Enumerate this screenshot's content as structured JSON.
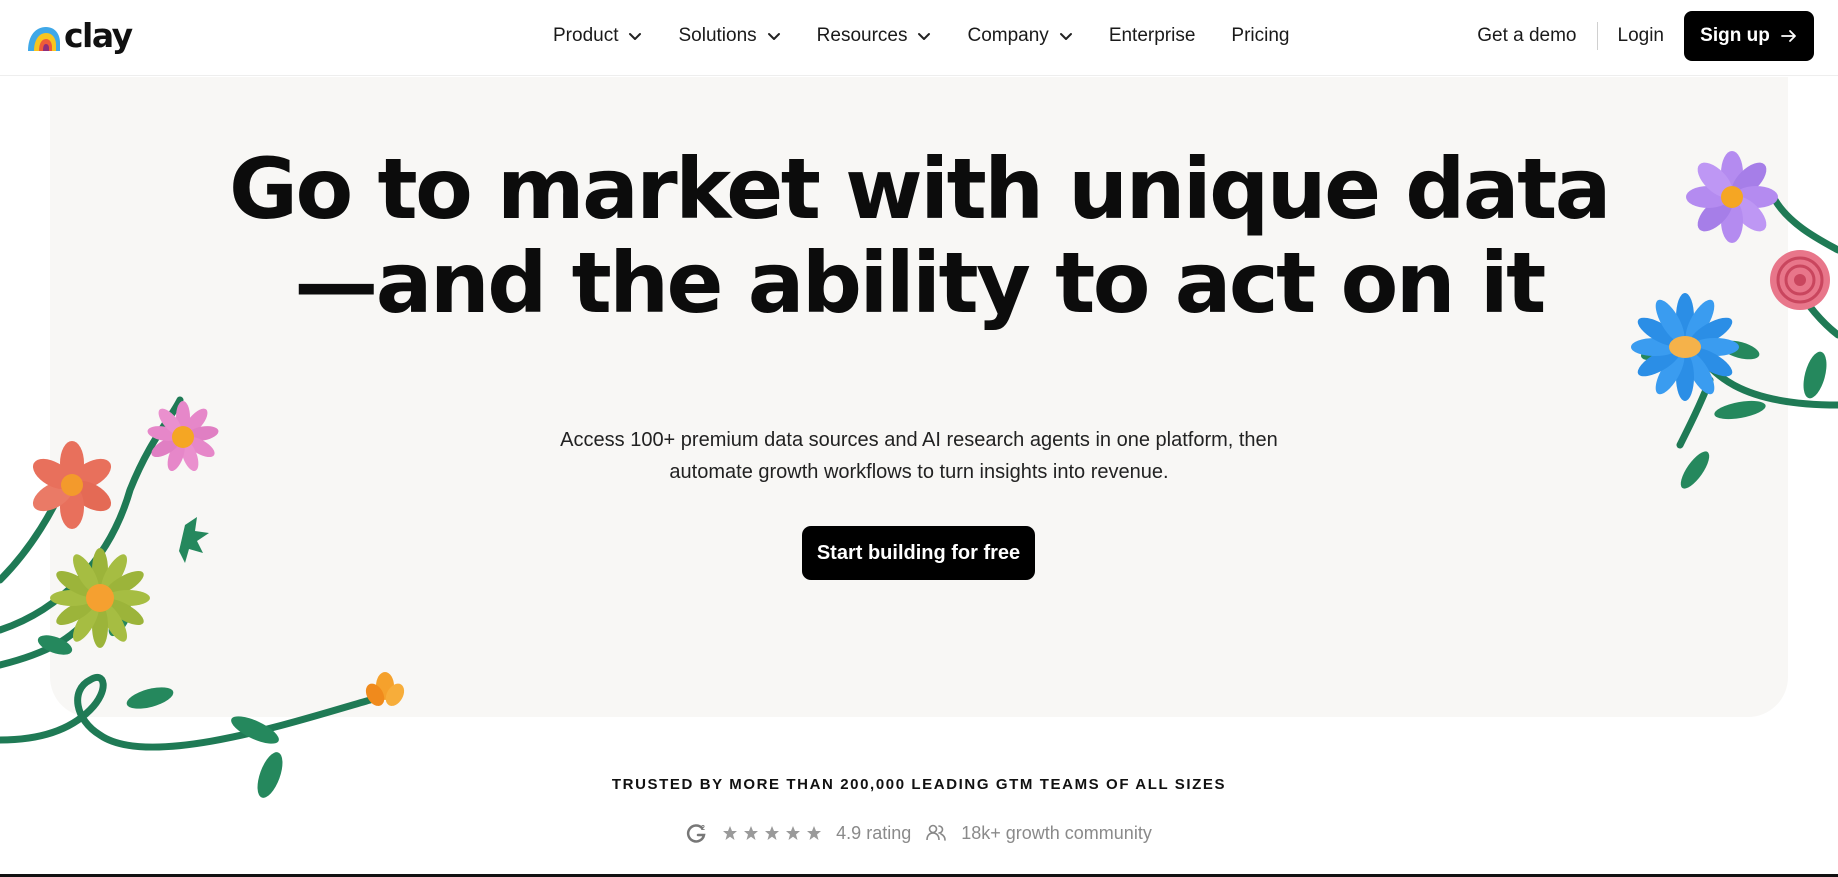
{
  "brand": {
    "name": "clay"
  },
  "nav": {
    "items": [
      {
        "label": "Product",
        "has_dropdown": true
      },
      {
        "label": "Solutions",
        "has_dropdown": true
      },
      {
        "label": "Resources",
        "has_dropdown": true
      },
      {
        "label": "Company",
        "has_dropdown": true
      },
      {
        "label": "Enterprise",
        "has_dropdown": false
      },
      {
        "label": "Pricing",
        "has_dropdown": false
      }
    ],
    "demo_label": "Get a demo",
    "login_label": "Login",
    "signup_label": "Sign up"
  },
  "hero": {
    "headline_line1": "Go to market with unique data",
    "headline_line2": "—and the ability to act on it",
    "sub_line1": "Access 100+ premium data sources and AI research agents in one platform, then",
    "sub_line2": "automate growth workflows to turn insights into revenue.",
    "cta_label": "Start building for free"
  },
  "trust": {
    "headline": "TRUSTED BY MORE THAN 200,000 LEADING GTM TEAMS OF ALL SIZES",
    "stars": 5,
    "rating_label": "4.9 rating",
    "community_label": "18k+ growth community"
  },
  "colors": {
    "hero_bg": "#f8f7f5",
    "button_bg": "#000000",
    "stem_green": "#1f7a55"
  },
  "icons": [
    "clay-logo-icon",
    "chevron-down-icon",
    "arrow-right-icon",
    "g2-icon",
    "star-icon",
    "people-icon"
  ]
}
